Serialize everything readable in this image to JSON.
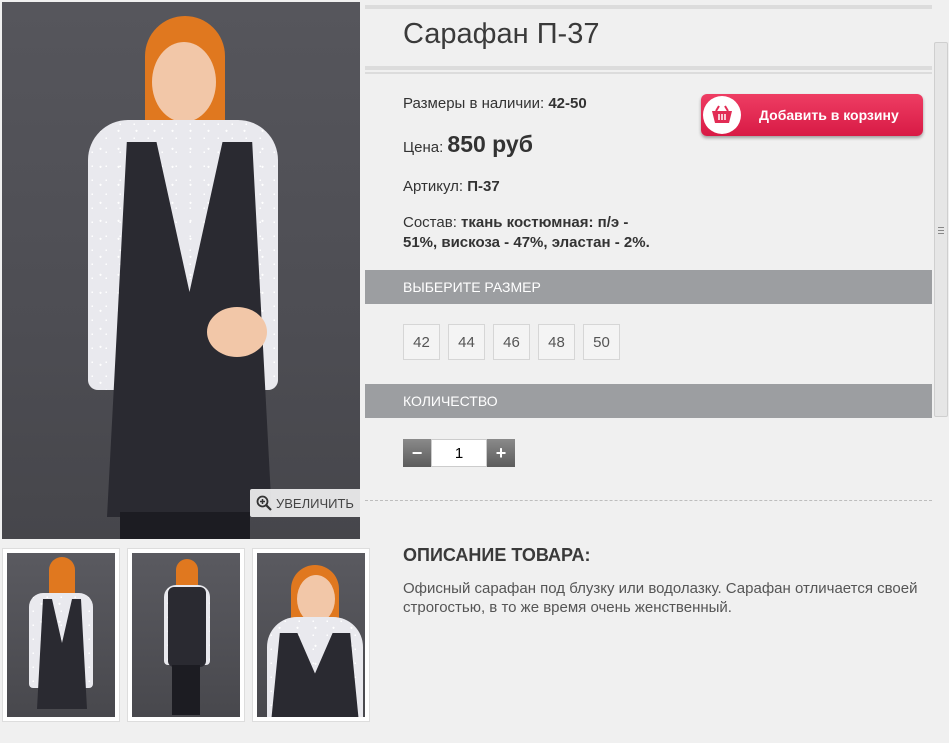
{
  "product": {
    "title": "Сарафан П-37",
    "sizes_label": "Размеры в наличии:",
    "sizes_value": "42-50",
    "price_label": "Цена:",
    "price_value": "850 руб",
    "article_label": "Артикул:",
    "article_value": "П-37",
    "composition_label": "Состав:",
    "composition_line1": "ткань костюмная: п/э -",
    "composition_line2": "51%, вискоза - 47%, эластан - 2%."
  },
  "cart_button": {
    "label": "Добавить в корзину",
    "icon": "basket-icon",
    "color": "#e22c55"
  },
  "gallery": {
    "zoom_label": "УВЕЛИЧИТЬ",
    "zoom_icon": "zoom-in-icon",
    "thumbnails": [
      "front-view",
      "back-view",
      "closeup-view"
    ]
  },
  "size_section": {
    "header": "ВЫБЕРИТЕ РАЗМЕР",
    "options": [
      "42",
      "44",
      "46",
      "48",
      "50"
    ]
  },
  "quantity_section": {
    "header": "КОЛИЧЕСТВО",
    "minus": "−",
    "plus": "+",
    "value": "1"
  },
  "description": {
    "title": "ОПИСАНИЕ ТОВАРА:",
    "text": "Офисный сарафан под блузку или водолазку. Сарафан отличается своей строгостью, в то же время очень женственный."
  },
  "colors": {
    "section_bar": "#9c9ea1",
    "background": "#f0f0f0",
    "accent": "#e22c55"
  }
}
